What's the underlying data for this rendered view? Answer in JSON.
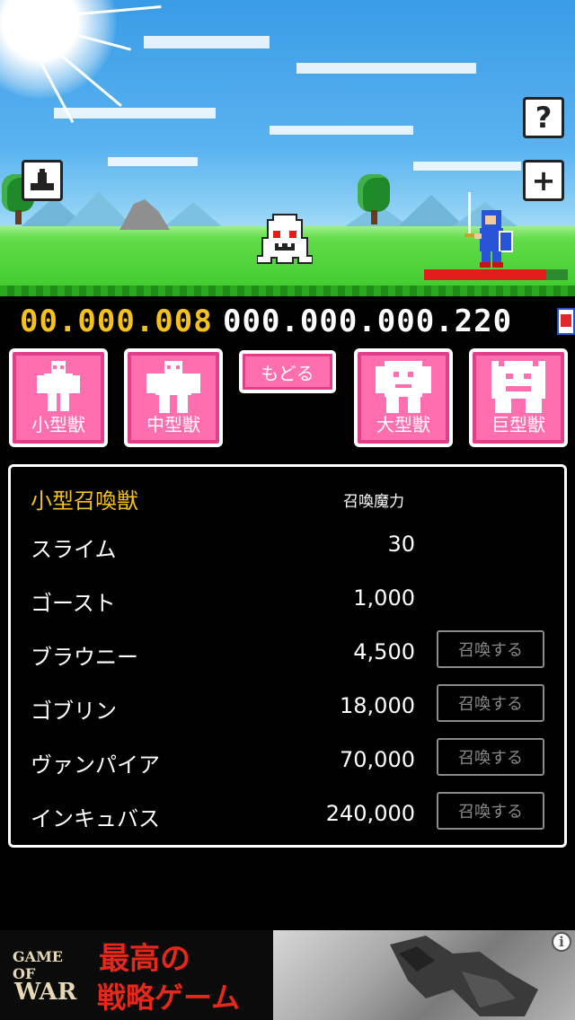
{
  "header": {
    "gold": "00.000.008",
    "power": "000.000.000.220",
    "hp_fraction": 0.85
  },
  "scene_buttons": {
    "help_icon": "?",
    "upload_icon": "upload-icon",
    "add_icon": "+"
  },
  "categories": [
    {
      "label": "小型獣"
    },
    {
      "label": "中型獣"
    },
    {
      "label": "大型獣"
    },
    {
      "label": "巨型獣"
    }
  ],
  "back_button": "もどる",
  "panel": {
    "title": "小型召喚獣",
    "column_header": "召喚魔力",
    "rows": [
      {
        "name": "スライム",
        "cost": "30",
        "button": ""
      },
      {
        "name": "ゴースト",
        "cost": "1,000",
        "button": ""
      },
      {
        "name": "ブラウニー",
        "cost": "4,500",
        "button": "召喚する"
      },
      {
        "name": "ゴブリン",
        "cost": "18,000",
        "button": "召喚する"
      },
      {
        "name": "ヴァンパイア",
        "cost": "70,000",
        "button": "召喚する"
      },
      {
        "name": "インキュバス",
        "cost": "240,000",
        "button": "召喚する"
      }
    ]
  },
  "ad": {
    "logo_line1": "GAME OF",
    "logo_line2": "WAR",
    "headline1": "最高の",
    "headline2": "戦略ゲーム",
    "info": "i"
  },
  "colors": {
    "gold": "#f4c21b",
    "pink": "#ff6fb0",
    "hp": "#e21b1b"
  }
}
